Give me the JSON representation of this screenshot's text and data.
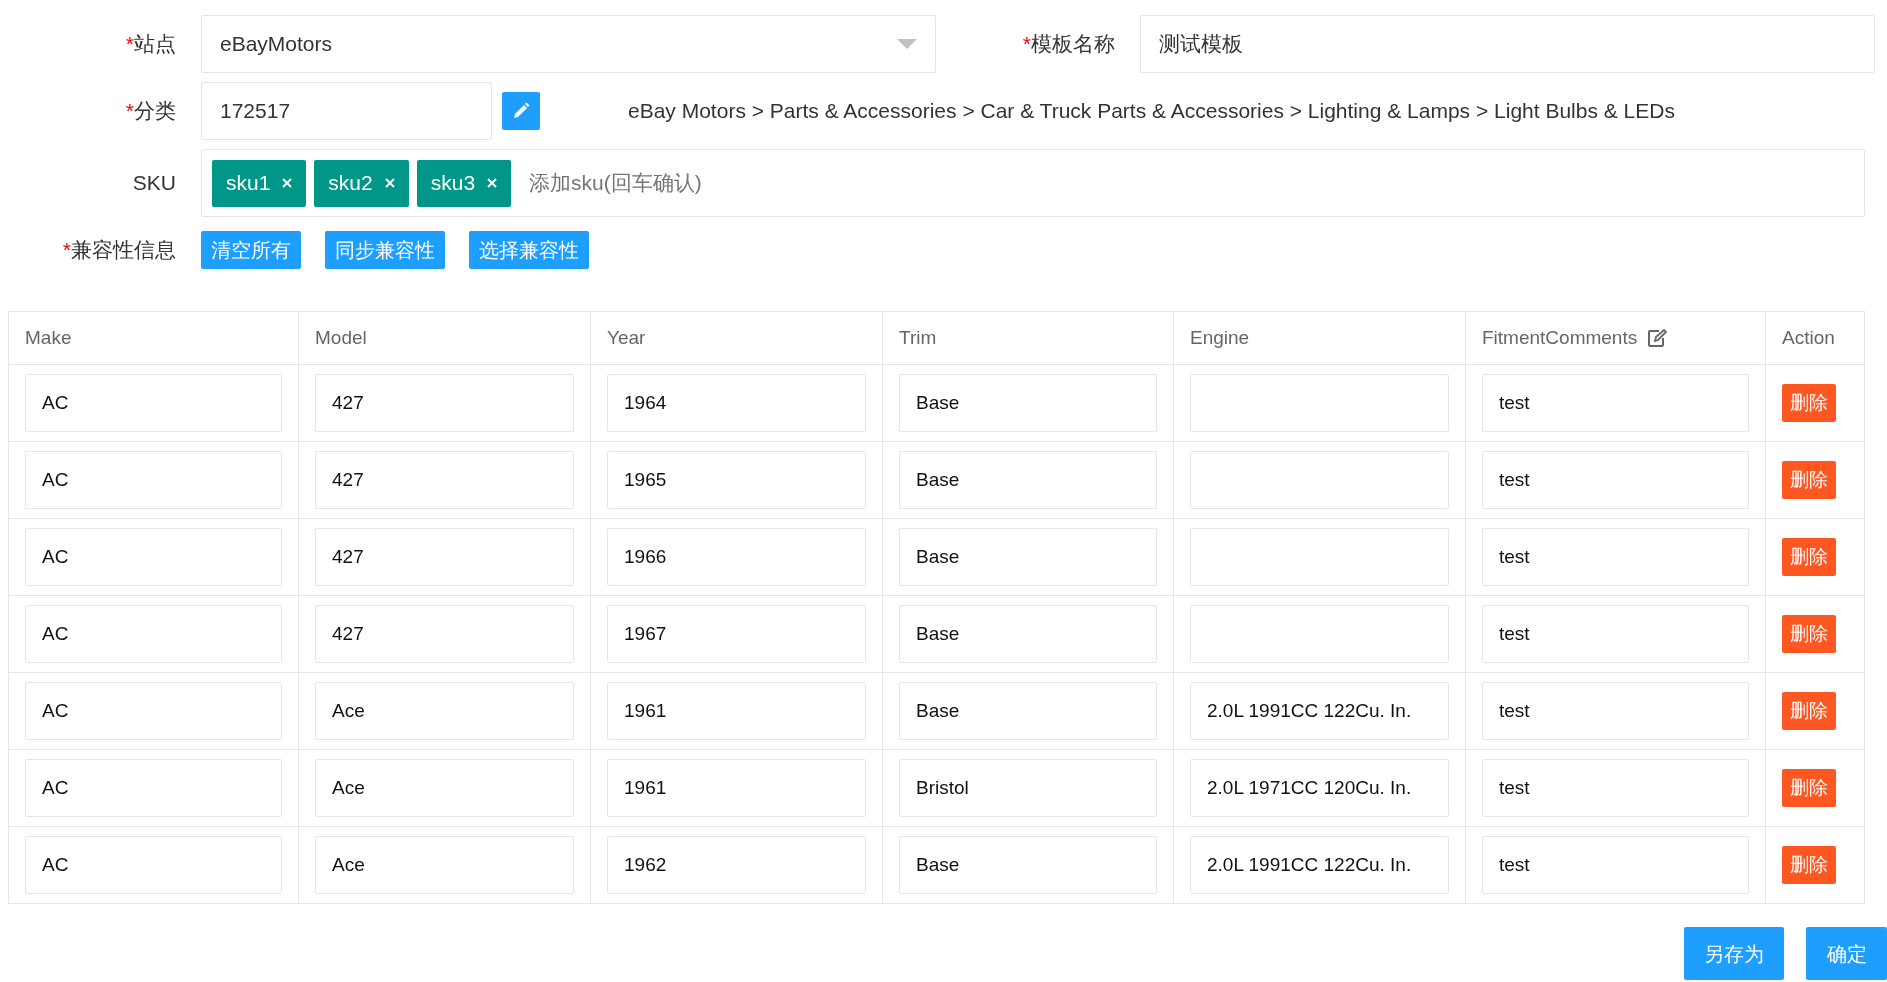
{
  "form": {
    "site": {
      "required_mark": "*",
      "label": "站点",
      "value": "eBayMotors"
    },
    "template_name": {
      "required_mark": "*",
      "label": "模板名称",
      "value": "测试模板"
    },
    "category": {
      "required_mark": "*",
      "label": "分类",
      "value": "172517",
      "path": "eBay Motors > Parts & Accessories > Car & Truck Parts & Accessories > Lighting & Lamps > Light Bulbs & LEDs"
    },
    "sku": {
      "label": "SKU",
      "tags": [
        "sku1",
        "sku2",
        "sku3"
      ],
      "placeholder": "添加sku(回车确认)"
    },
    "compatibility": {
      "required_mark": "*",
      "label": "兼容性信息",
      "buttons": [
        "清空所有",
        "同步兼容性",
        "选择兼容性"
      ]
    }
  },
  "table": {
    "columns": [
      {
        "label": "Make",
        "editable": false
      },
      {
        "label": "Model",
        "editable": false
      },
      {
        "label": "Year",
        "editable": false
      },
      {
        "label": "Trim",
        "editable": false
      },
      {
        "label": "Engine",
        "editable": false
      },
      {
        "label": "FitmentComments",
        "editable": true
      },
      {
        "label": "Action",
        "editable": false
      }
    ],
    "rows": [
      {
        "cells": [
          "AC",
          "427",
          "1964",
          "Base",
          "",
          "test"
        ],
        "action": "删除"
      },
      {
        "cells": [
          "AC",
          "427",
          "1965",
          "Base",
          "",
          "test"
        ],
        "action": "删除"
      },
      {
        "cells": [
          "AC",
          "427",
          "1966",
          "Base",
          "",
          "test"
        ],
        "action": "删除"
      },
      {
        "cells": [
          "AC",
          "427",
          "1967",
          "Base",
          "",
          "test"
        ],
        "action": "删除"
      },
      {
        "cells": [
          "AC",
          "Ace",
          "1961",
          "Base",
          "2.0L 1991CC 122Cu. In.",
          "test"
        ],
        "action": "删除"
      },
      {
        "cells": [
          "AC",
          "Ace",
          "1961",
          "Bristol",
          "2.0L 1971CC 120Cu. In.",
          "test"
        ],
        "action": "删除"
      },
      {
        "cells": [
          "AC",
          "Ace",
          "1962",
          "Base",
          "2.0L 1991CC 122Cu. In.",
          "test"
        ],
        "action": "删除"
      }
    ]
  },
  "footer_buttons": [
    "另存为",
    "确定"
  ]
}
